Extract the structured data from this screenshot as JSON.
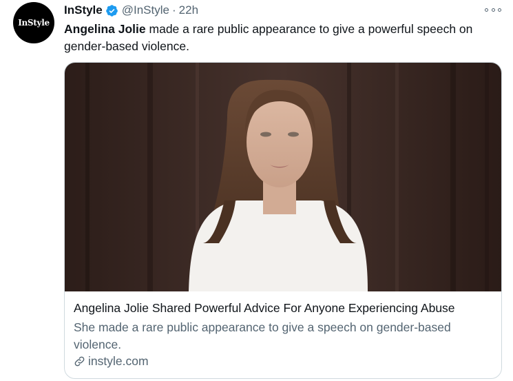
{
  "account": {
    "avatar_text": "InStyle",
    "display_name": "InStyle",
    "verified": true,
    "handle": "@InStyle",
    "separator": "·",
    "timestamp": "22h"
  },
  "icons": {
    "verified": "verified-badge-icon",
    "more": "more-options-icon",
    "link": "link-icon"
  },
  "tweet": {
    "mention_bold": "Angelina Jolie",
    "text_rest": " made a rare public appearance to give a powerful speech on gender-based violence."
  },
  "card": {
    "title": "Angelina Jolie Shared Powerful Advice For Anyone Experiencing Abuse",
    "description": "She made a rare public appearance to give a speech on gender-based violence.",
    "domain": "instyle.com"
  },
  "colors": {
    "verified_blue": "#1d9bf0",
    "text_primary": "#0f1419",
    "text_secondary": "#536471",
    "border": "#cfd9de"
  }
}
